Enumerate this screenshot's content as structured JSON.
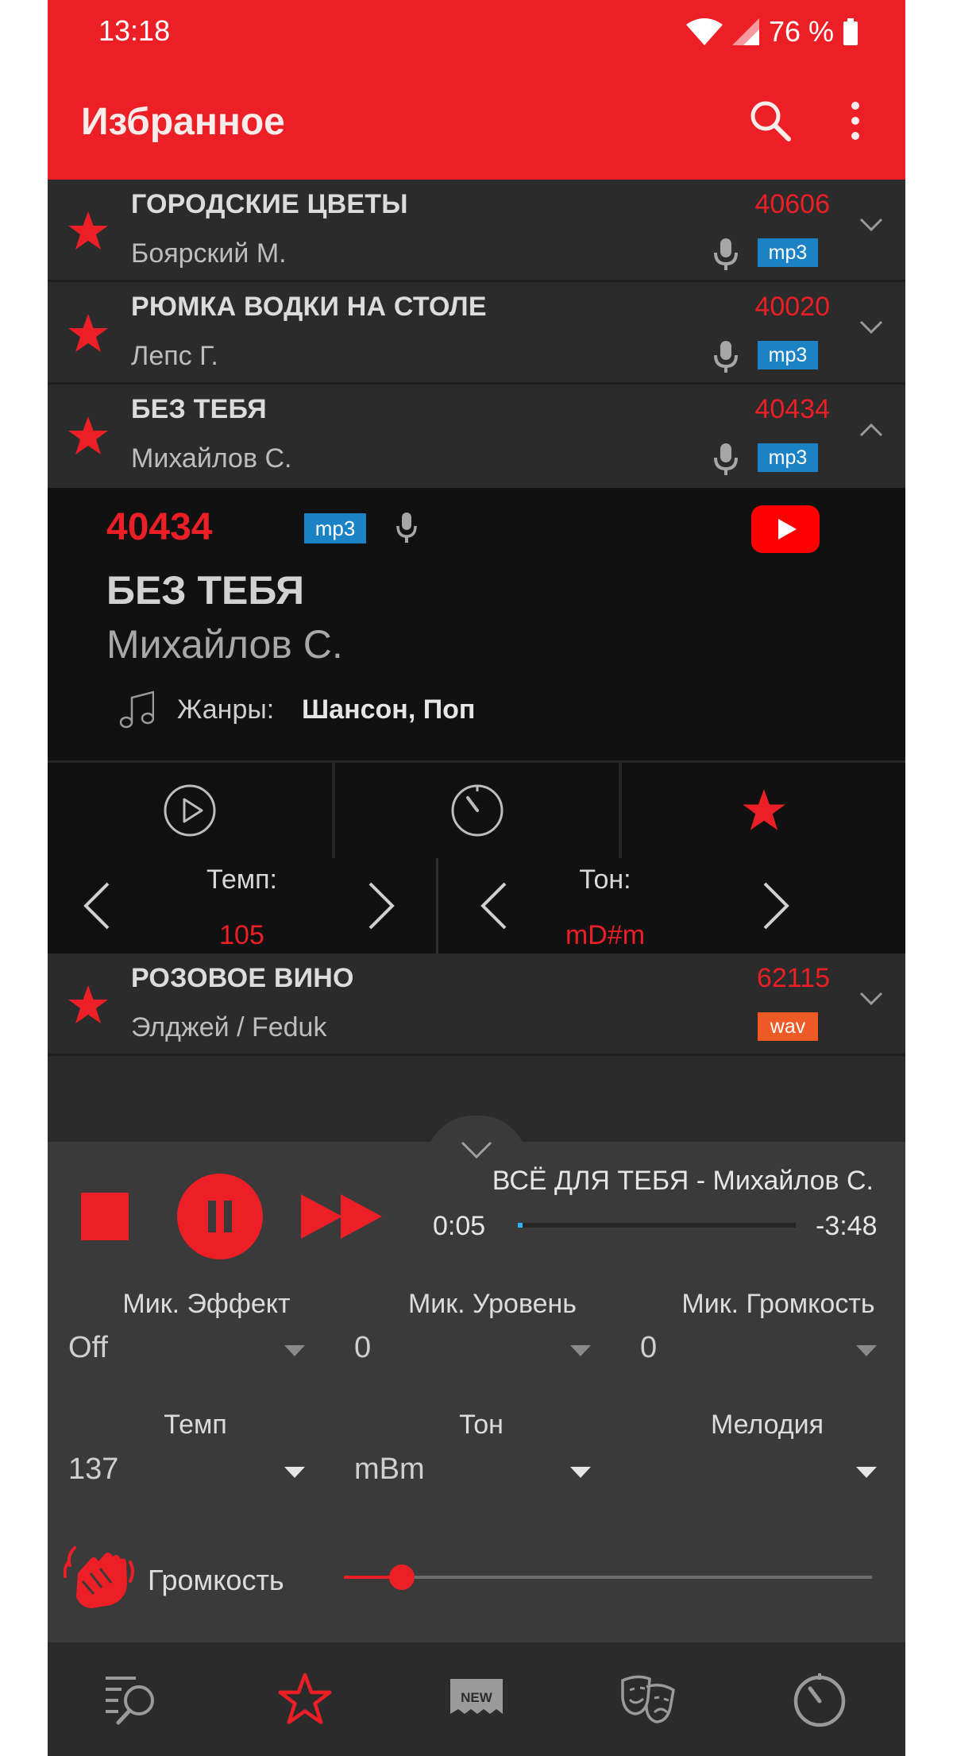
{
  "status_bar": {
    "time": "13:18",
    "battery": "76 %"
  },
  "header": {
    "title": "Избранное"
  },
  "songs": [
    {
      "title": "ГОРОДСКИЕ ЦВЕТЫ",
      "artist": "Боярский М.",
      "number": "40606",
      "format": "mp3",
      "mic": true,
      "expanded": false
    },
    {
      "title": "РЮМКА ВОДКИ НА СТОЛЕ",
      "artist": "Лепс Г.",
      "number": "40020",
      "format": "mp3",
      "mic": true,
      "expanded": false
    },
    {
      "title": "БЕЗ ТЕБЯ",
      "artist": "Михайлов С.",
      "number": "40434",
      "format": "mp3",
      "mic": true,
      "expanded": true
    },
    {
      "title": "РОЗОВОЕ ВИНО",
      "artist": "Элджей / Feduk",
      "number": "62115",
      "format": "wav",
      "mic": false,
      "expanded": false
    }
  ],
  "detail": {
    "number": "40434",
    "format": "mp3",
    "title": "БЕЗ ТЕБЯ",
    "artist": "Михайлов С.",
    "genres_label": "Жанры:",
    "genres": "Шансон, Поп",
    "tempo_label": "Темп:",
    "tempo_value": "105",
    "key_label": "Тон:",
    "key_value": "mD#m"
  },
  "player": {
    "now_playing": "ВСЁ ДЛЯ ТЕБЯ - Михайлов С.",
    "elapsed": "0:05",
    "remaining": "-3:48",
    "progress": 0.015,
    "mic_effect": {
      "label": "Мик. Эффект",
      "value": "Off"
    },
    "mic_level": {
      "label": "Мик. Уровень",
      "value": "0"
    },
    "mic_volume": {
      "label": "Мик. Громкость",
      "value": "0"
    },
    "tempo": {
      "label": "Темп",
      "value": "137"
    },
    "key": {
      "label": "Тон",
      "value": "mBm"
    },
    "melody": {
      "label": "Мелодия",
      "value": ""
    },
    "volume_label": "Громкость",
    "volume": 0.11
  },
  "bottom_nav": [
    {
      "icon": "search-list-icon",
      "active": false
    },
    {
      "icon": "star-outline-icon",
      "active": true
    },
    {
      "icon": "new-badge-icon",
      "label": "NEW",
      "active": false
    },
    {
      "icon": "theater-masks-icon",
      "active": false
    },
    {
      "icon": "timer-icon",
      "active": false
    }
  ],
  "colors": {
    "accent": "#ec1f26",
    "mp3_badge": "#1b82c5",
    "wav_badge": "#ee5a26",
    "progress": "#2ab4f3"
  }
}
